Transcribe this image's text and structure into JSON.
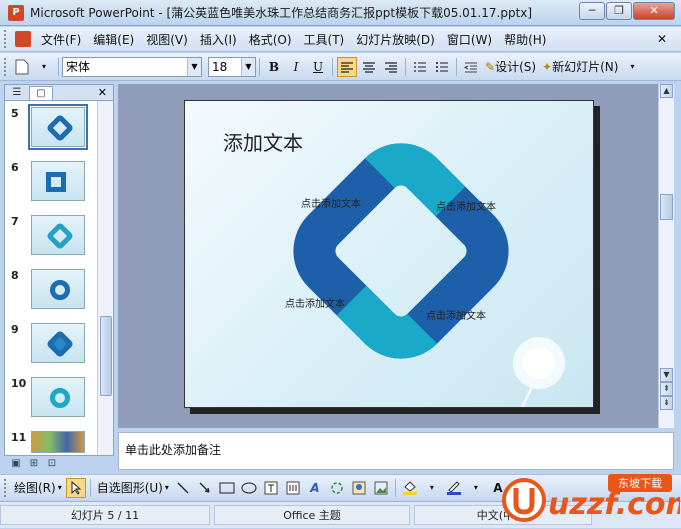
{
  "window": {
    "title": "Microsoft PowerPoint - [蒲公英蓝色唯美水珠工作总结商务汇报ppt模板下载05.01.17.pptx]"
  },
  "menu": [
    "文件(F)",
    "编辑(E)",
    "视图(V)",
    "插入(I)",
    "格式(O)",
    "工具(T)",
    "幻灯片放映(D)",
    "窗口(W)",
    "帮助(H)"
  ],
  "toolbar": {
    "font_name": "宋体",
    "font_size": "18",
    "bold": "B",
    "italic": "I",
    "underline": "U",
    "design_label": "设计(S)",
    "new_slide_label": "新幻灯片(N)"
  },
  "thumbnails": [
    {
      "num": "5",
      "selected": true
    },
    {
      "num": "6",
      "selected": false
    },
    {
      "num": "7",
      "selected": false
    },
    {
      "num": "8",
      "selected": false
    },
    {
      "num": "9",
      "selected": false
    },
    {
      "num": "10",
      "selected": false
    },
    {
      "num": "11",
      "selected": false
    }
  ],
  "slide": {
    "title": "添加文本",
    "labels": [
      "点击添加文本",
      "点击添加文本",
      "点击添加文本",
      "点击添加文本"
    ]
  },
  "notes": {
    "placeholder": "单击此处添加备注"
  },
  "drawbar": {
    "draw_label": "绘图(R)",
    "autoshape_label": "自选图形(U)"
  },
  "status": {
    "slide_info": "幻灯片 5 / 11",
    "theme": "Office 主题",
    "language": "中文(中国)"
  },
  "watermark": {
    "text": "uzzf.com",
    "badge": "东坡下载"
  },
  "colors": {
    "accent_dark": "#1d5fa8",
    "accent_light": "#1aa9c9",
    "slide_bg": "#d9eff7"
  }
}
